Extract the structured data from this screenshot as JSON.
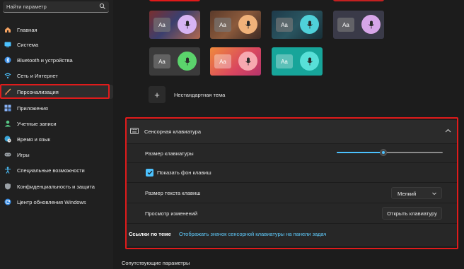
{
  "search": {
    "placeholder": "Найти параметр",
    "icon": "search-icon"
  },
  "sidebar": {
    "items": [
      {
        "label": "Главная",
        "icon": "home-icon"
      },
      {
        "label": "Система",
        "icon": "system-icon"
      },
      {
        "label": "Bluetooth и устройства",
        "icon": "bluetooth-icon"
      },
      {
        "label": "Сеть и Интернет",
        "icon": "wifi-icon"
      },
      {
        "label": "Персонализация",
        "icon": "brush-icon",
        "active": true
      },
      {
        "label": "Приложения",
        "icon": "apps-icon"
      },
      {
        "label": "Учетные записи",
        "icon": "person-icon"
      },
      {
        "label": "Время и язык",
        "icon": "globe-clock-icon"
      },
      {
        "label": "Игры",
        "icon": "gamepad-icon"
      },
      {
        "label": "Специальные возможности",
        "icon": "accessibility-icon"
      },
      {
        "label": "Конфиденциальность и защита",
        "icon": "shield-icon"
      },
      {
        "label": "Центр обновления Windows",
        "icon": "update-icon"
      }
    ]
  },
  "themes": {
    "tile_text": "Aa",
    "custom_theme_label": "Нестандартная тема",
    "plus_symbol": "+"
  },
  "touch_keyboard": {
    "title": "Сенсорная клавиатура",
    "icon": "keyboard-icon",
    "size_label": "Размер клавиатуры",
    "size_value_fraction": 0.44,
    "show_key_bg_label": "Показать фон клавиш",
    "show_key_bg_checked": true,
    "text_size_label": "Размер текста клавиш",
    "text_size_value": "Мелкий",
    "preview_label": "Просмотр изменений",
    "open_keyboard_button": "Открыть клавиатуру"
  },
  "related_links": {
    "label": "Ссылки по теме",
    "link": "Отображать значок сенсорной клавиатуры на панели задач"
  },
  "related_settings": {
    "label": "Сопутствующие параметры"
  },
  "colors": {
    "accent": "#4cc2ff",
    "highlight": "#e01b1b",
    "link": "#60cdff"
  }
}
